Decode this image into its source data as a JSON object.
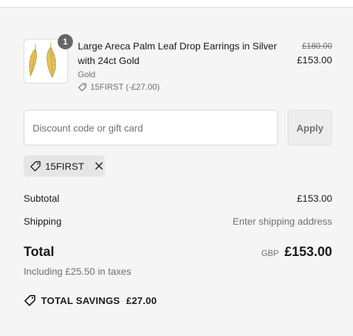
{
  "line_item": {
    "quantity": "1",
    "title": "Large Areca Palm Leaf Drop Earrings in Silver with 24ct Gold",
    "variant": "Gold",
    "discount": "15FIRST (-£27.00)",
    "compare_price": "£180.00",
    "price": "£153.00",
    "image_icon": "gold-leaf-earrings-image"
  },
  "discount_form": {
    "placeholder": "Discount code or gift card",
    "value": "",
    "apply_label": "Apply"
  },
  "applied_code": {
    "label": "15FIRST"
  },
  "summary": {
    "subtotal_label": "Subtotal",
    "subtotal_value": "£153.00",
    "shipping_label": "Shipping",
    "shipping_value": "Enter shipping address",
    "total_label": "Total",
    "currency": "GBP",
    "total_value": "£153.00",
    "taxes_note": "Including £25.50 in taxes",
    "savings_label": "TOTAL SAVINGS",
    "savings_value": "£27.00"
  },
  "colors": {
    "background": "#f5f5f5",
    "text": "#1a1a1a",
    "muted": "#707070",
    "gold": "#d9b54a"
  }
}
